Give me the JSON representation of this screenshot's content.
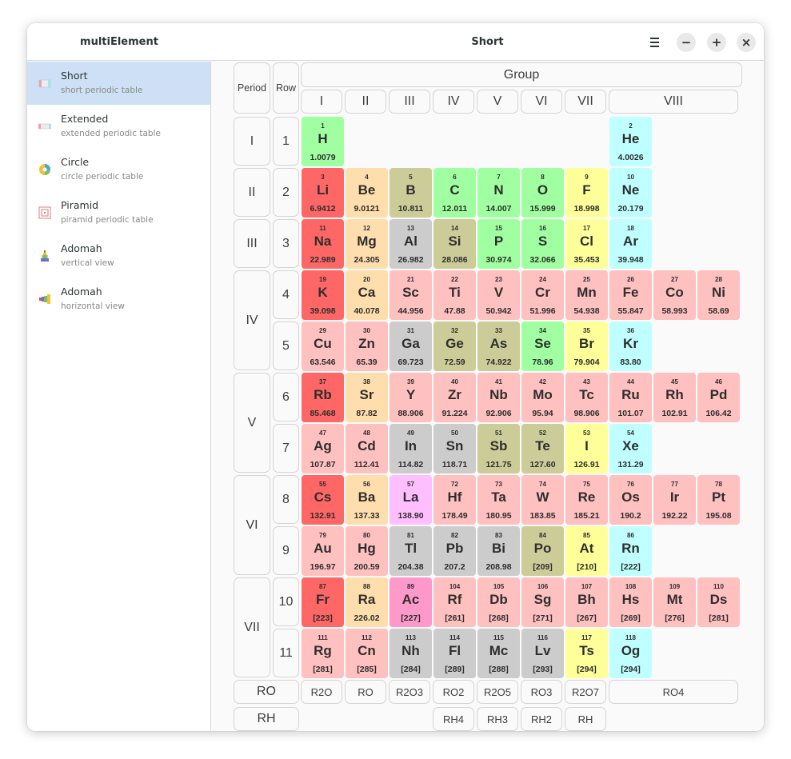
{
  "window": {
    "app_title": "multiElement",
    "view_title": "Short",
    "controls": {
      "minimize": "−",
      "maximize": "+",
      "close": "×"
    }
  },
  "sidebar": {
    "items": [
      {
        "label": "Short",
        "subtitle": "short periodic table",
        "icon": "short-table-icon",
        "active": true
      },
      {
        "label": "Extended",
        "subtitle": "extended periodic table",
        "icon": "extended-table-icon",
        "active": false
      },
      {
        "label": "Circle",
        "subtitle": "circle periodic table",
        "icon": "circle-table-icon",
        "active": false
      },
      {
        "label": "Piramid",
        "subtitle": "piramid periodic table",
        "icon": "piramid-table-icon",
        "active": false
      },
      {
        "label": "Adomah",
        "subtitle": "vertical view",
        "icon": "adomah-vertical-icon",
        "active": false
      },
      {
        "label": "Adomah",
        "subtitle": "horizontal view",
        "icon": "adomah-horizontal-icon",
        "active": false
      }
    ]
  },
  "table": {
    "headers": {
      "period": "Period",
      "row": "Row",
      "group": "Group"
    },
    "groups": [
      "I",
      "II",
      "III",
      "IV",
      "V",
      "VI",
      "VII",
      "VIII"
    ],
    "periods": [
      "I",
      "II",
      "III",
      "IV",
      "V",
      "VI",
      "VII"
    ],
    "rows": [
      "1",
      "2",
      "3",
      "4",
      "5",
      "6",
      "7",
      "8",
      "9",
      "10",
      "11"
    ],
    "oxides_label": "RO",
    "oxides": [
      "R2O",
      "RO",
      "R2O3",
      "RO2",
      "R2O5",
      "RO3",
      "R2O7",
      "RO4"
    ],
    "hydrides_label": "RH",
    "hydrides": [
      "RH4",
      "RH3",
      "RH2",
      "RH"
    ],
    "category_colors": {
      "alkali": "#ff6666",
      "alkaline": "#ffdead",
      "transition": "#ffc0c0",
      "post_transition": "#cccccc",
      "metalloid": "#cccc99",
      "nonmetal": "#a0ffa0",
      "halogen": "#ffff99",
      "noble": "#c0ffff",
      "lanthanide": "#ffbfff",
      "actinide": "#ff99cc"
    },
    "elements": [
      {
        "n": "1",
        "s": "H",
        "m": "1.0079",
        "c": "nonmetal"
      },
      {
        "n": "2",
        "s": "He",
        "m": "4.0026",
        "c": "noble"
      },
      {
        "n": "3",
        "s": "Li",
        "m": "6.9412",
        "c": "alkali"
      },
      {
        "n": "4",
        "s": "Be",
        "m": "9.0121",
        "c": "alkaline"
      },
      {
        "n": "5",
        "s": "B",
        "m": "10.811",
        "c": "metalloid"
      },
      {
        "n": "6",
        "s": "C",
        "m": "12.011",
        "c": "nonmetal"
      },
      {
        "n": "7",
        "s": "N",
        "m": "14.007",
        "c": "nonmetal"
      },
      {
        "n": "8",
        "s": "O",
        "m": "15.999",
        "c": "nonmetal"
      },
      {
        "n": "9",
        "s": "F",
        "m": "18.998",
        "c": "halogen"
      },
      {
        "n": "10",
        "s": "Ne",
        "m": "20.179",
        "c": "noble"
      },
      {
        "n": "11",
        "s": "Na",
        "m": "22.989",
        "c": "alkali"
      },
      {
        "n": "12",
        "s": "Mg",
        "m": "24.305",
        "c": "alkaline"
      },
      {
        "n": "13",
        "s": "Al",
        "m": "26.982",
        "c": "post_transition"
      },
      {
        "n": "14",
        "s": "Si",
        "m": "28.086",
        "c": "metalloid"
      },
      {
        "n": "15",
        "s": "P",
        "m": "30.974",
        "c": "nonmetal"
      },
      {
        "n": "16",
        "s": "S",
        "m": "32.066",
        "c": "nonmetal"
      },
      {
        "n": "17",
        "s": "Cl",
        "m": "35.453",
        "c": "halogen"
      },
      {
        "n": "18",
        "s": "Ar",
        "m": "39.948",
        "c": "noble"
      },
      {
        "n": "19",
        "s": "K",
        "m": "39.098",
        "c": "alkali"
      },
      {
        "n": "20",
        "s": "Ca",
        "m": "40.078",
        "c": "alkaline"
      },
      {
        "n": "21",
        "s": "Sc",
        "m": "44.956",
        "c": "transition"
      },
      {
        "n": "22",
        "s": "Ti",
        "m": "47.88",
        "c": "transition"
      },
      {
        "n": "23",
        "s": "V",
        "m": "50.942",
        "c": "transition"
      },
      {
        "n": "24",
        "s": "Cr",
        "m": "51.996",
        "c": "transition"
      },
      {
        "n": "25",
        "s": "Mn",
        "m": "54.938",
        "c": "transition"
      },
      {
        "n": "26",
        "s": "Fe",
        "m": "55.847",
        "c": "transition"
      },
      {
        "n": "27",
        "s": "Co",
        "m": "58.993",
        "c": "transition"
      },
      {
        "n": "28",
        "s": "Ni",
        "m": "58.69",
        "c": "transition"
      },
      {
        "n": "29",
        "s": "Cu",
        "m": "63.546",
        "c": "transition"
      },
      {
        "n": "30",
        "s": "Zn",
        "m": "65.39",
        "c": "transition"
      },
      {
        "n": "31",
        "s": "Ga",
        "m": "69.723",
        "c": "post_transition"
      },
      {
        "n": "32",
        "s": "Ge",
        "m": "72.59",
        "c": "metalloid"
      },
      {
        "n": "33",
        "s": "As",
        "m": "74.922",
        "c": "metalloid"
      },
      {
        "n": "34",
        "s": "Se",
        "m": "78.96",
        "c": "nonmetal"
      },
      {
        "n": "35",
        "s": "Br",
        "m": "79.904",
        "c": "halogen"
      },
      {
        "n": "36",
        "s": "Kr",
        "m": "83.80",
        "c": "noble"
      },
      {
        "n": "37",
        "s": "Rb",
        "m": "85.468",
        "c": "alkali"
      },
      {
        "n": "38",
        "s": "Sr",
        "m": "87.82",
        "c": "alkaline"
      },
      {
        "n": "39",
        "s": "Y",
        "m": "88.906",
        "c": "transition"
      },
      {
        "n": "40",
        "s": "Zr",
        "m": "91.224",
        "c": "transition"
      },
      {
        "n": "41",
        "s": "Nb",
        "m": "92.906",
        "c": "transition"
      },
      {
        "n": "42",
        "s": "Mo",
        "m": "95.94",
        "c": "transition"
      },
      {
        "n": "43",
        "s": "Tc",
        "m": "98.906",
        "c": "transition"
      },
      {
        "n": "44",
        "s": "Ru",
        "m": "101.07",
        "c": "transition"
      },
      {
        "n": "45",
        "s": "Rh",
        "m": "102.91",
        "c": "transition"
      },
      {
        "n": "46",
        "s": "Pd",
        "m": "106.42",
        "c": "transition"
      },
      {
        "n": "47",
        "s": "Ag",
        "m": "107.87",
        "c": "transition"
      },
      {
        "n": "48",
        "s": "Cd",
        "m": "112.41",
        "c": "transition"
      },
      {
        "n": "49",
        "s": "In",
        "m": "114.82",
        "c": "post_transition"
      },
      {
        "n": "50",
        "s": "Sn",
        "m": "118.71",
        "c": "post_transition"
      },
      {
        "n": "51",
        "s": "Sb",
        "m": "121.75",
        "c": "metalloid"
      },
      {
        "n": "52",
        "s": "Te",
        "m": "127.60",
        "c": "metalloid"
      },
      {
        "n": "53",
        "s": "I",
        "m": "126.91",
        "c": "halogen"
      },
      {
        "n": "54",
        "s": "Xe",
        "m": "131.29",
        "c": "noble"
      },
      {
        "n": "55",
        "s": "Cs",
        "m": "132.91",
        "c": "alkali"
      },
      {
        "n": "56",
        "s": "Ba",
        "m": "137.33",
        "c": "alkaline"
      },
      {
        "n": "57",
        "s": "La",
        "m": "138.90",
        "c": "lanthanide"
      },
      {
        "n": "72",
        "s": "Hf",
        "m": "178.49",
        "c": "transition"
      },
      {
        "n": "73",
        "s": "Ta",
        "m": "180.95",
        "c": "transition"
      },
      {
        "n": "74",
        "s": "W",
        "m": "183.85",
        "c": "transition"
      },
      {
        "n": "75",
        "s": "Re",
        "m": "185.21",
        "c": "transition"
      },
      {
        "n": "76",
        "s": "Os",
        "m": "190.2",
        "c": "transition"
      },
      {
        "n": "77",
        "s": "Ir",
        "m": "192.22",
        "c": "transition"
      },
      {
        "n": "78",
        "s": "Pt",
        "m": "195.08",
        "c": "transition"
      },
      {
        "n": "79",
        "s": "Au",
        "m": "196.97",
        "c": "transition"
      },
      {
        "n": "80",
        "s": "Hg",
        "m": "200.59",
        "c": "transition"
      },
      {
        "n": "81",
        "s": "Tl",
        "m": "204.38",
        "c": "post_transition"
      },
      {
        "n": "82",
        "s": "Pb",
        "m": "207.2",
        "c": "post_transition"
      },
      {
        "n": "83",
        "s": "Bi",
        "m": "208.98",
        "c": "post_transition"
      },
      {
        "n": "84",
        "s": "Po",
        "m": "[209]",
        "c": "metalloid"
      },
      {
        "n": "85",
        "s": "At",
        "m": "[210]",
        "c": "halogen"
      },
      {
        "n": "86",
        "s": "Rn",
        "m": "[222]",
        "c": "noble"
      },
      {
        "n": "87",
        "s": "Fr",
        "m": "[223]",
        "c": "alkali"
      },
      {
        "n": "88",
        "s": "Ra",
        "m": "226.02",
        "c": "alkaline"
      },
      {
        "n": "89",
        "s": "Ac",
        "m": "[227]",
        "c": "actinide"
      },
      {
        "n": "104",
        "s": "Rf",
        "m": "[261]",
        "c": "transition"
      },
      {
        "n": "105",
        "s": "Db",
        "m": "[268]",
        "c": "transition"
      },
      {
        "n": "106",
        "s": "Sg",
        "m": "[271]",
        "c": "transition"
      },
      {
        "n": "107",
        "s": "Bh",
        "m": "[267]",
        "c": "transition"
      },
      {
        "n": "108",
        "s": "Hs",
        "m": "[269]",
        "c": "transition"
      },
      {
        "n": "109",
        "s": "Mt",
        "m": "[276]",
        "c": "transition"
      },
      {
        "n": "110",
        "s": "Ds",
        "m": "[281]",
        "c": "transition"
      },
      {
        "n": "111",
        "s": "Rg",
        "m": "[281]",
        "c": "transition"
      },
      {
        "n": "112",
        "s": "Cn",
        "m": "[285]",
        "c": "transition"
      },
      {
        "n": "113",
        "s": "Nh",
        "m": "[284]",
        "c": "post_transition"
      },
      {
        "n": "114",
        "s": "Fl",
        "m": "[289]",
        "c": "post_transition"
      },
      {
        "n": "115",
        "s": "Mc",
        "m": "[288]",
        "c": "post_transition"
      },
      {
        "n": "116",
        "s": "Lv",
        "m": "[293]",
        "c": "post_transition"
      },
      {
        "n": "117",
        "s": "Ts",
        "m": "[294]",
        "c": "halogen"
      },
      {
        "n": "118",
        "s": "Og",
        "m": "[294]",
        "c": "noble"
      }
    ]
  }
}
